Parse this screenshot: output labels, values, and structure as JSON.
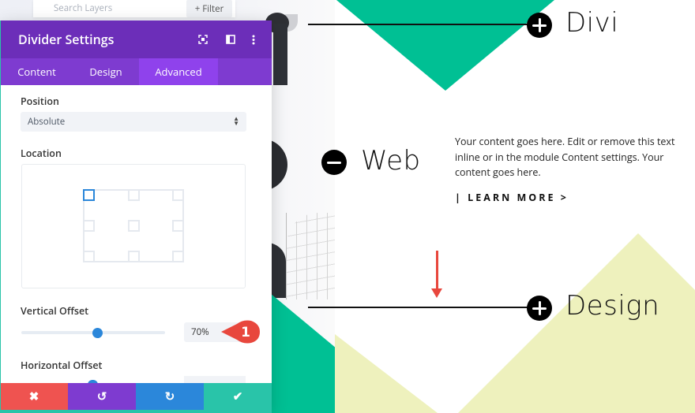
{
  "layers": {
    "search_placeholder": "Search Layers",
    "filter_label": "+ Filter"
  },
  "modal": {
    "title": "Divider Settings",
    "header_icons": [
      "fullscreen-icon",
      "split-view-icon",
      "more-options-icon"
    ],
    "tabs": [
      {
        "label": "Content",
        "active": false
      },
      {
        "label": "Design",
        "active": false
      },
      {
        "label": "Advanced",
        "active": true
      }
    ],
    "position": {
      "label": "Position",
      "value": "Absolute"
    },
    "location": {
      "label": "Location",
      "selected": "top-left"
    },
    "vertical_offset": {
      "label": "Vertical Offset",
      "value": "70%",
      "slider_fraction": 0.53
    },
    "horizontal_offset": {
      "label": "Horizontal Offset"
    },
    "annotation_badge": "1",
    "footer": {
      "cancel_icon": "✖",
      "undo_icon": "↺",
      "redo_icon": "↻",
      "save_icon": "✔"
    }
  },
  "canvas": {
    "items": [
      {
        "word": "Divi",
        "toggle": "plus"
      },
      {
        "word": "Web",
        "toggle": "minus"
      },
      {
        "word": "Design",
        "toggle": "plus"
      }
    ],
    "body_text": "Your content goes here. Edit or remove this text inline or in the module Content settings. Your content goes here.",
    "learn_more": "| LEARN MORE >"
  },
  "colors": {
    "header_purple": "#6c2eb9",
    "tab_purple": "#7e3bd0",
    "tab_active": "#8f42ec",
    "accent_blue": "#2b87da",
    "cancel_red": "#ef5350",
    "undo_purple": "#7e3bd0",
    "redo_blue": "#2b87da",
    "save_teal": "#29c4a9",
    "green_shape": "#00c094",
    "yellow_shape": "#eef1bd",
    "annotation_red": "#e8473d"
  }
}
